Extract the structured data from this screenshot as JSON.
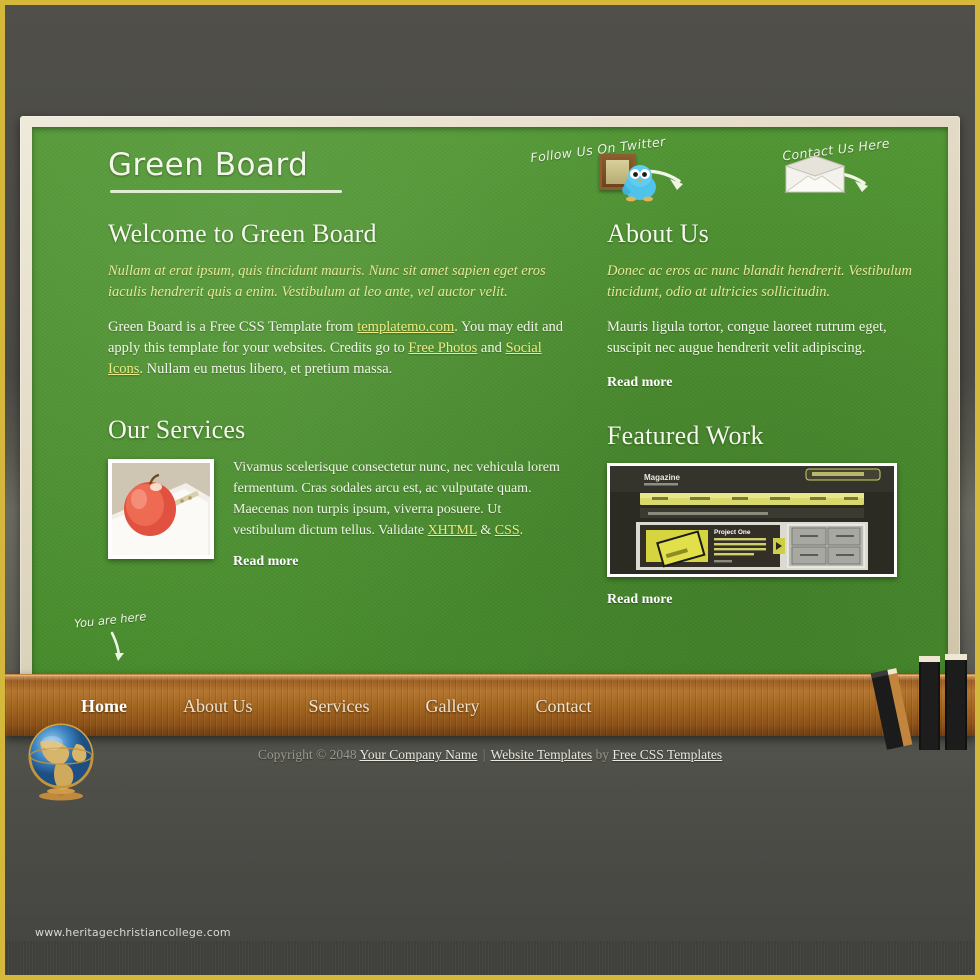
{
  "site": {
    "logo": "Green Board",
    "watermark": "www.heritagechristiancollege.com"
  },
  "header": {
    "twitter_caption": "Follow Us On Twitter",
    "contact_caption": "Contact Us Here",
    "twitter_icon": "twitter-bird-icon",
    "contact_icon": "envelope-icon"
  },
  "main": {
    "welcome": {
      "title": "Welcome to Green Board",
      "intro": "Nullam at erat ipsum, quis tincidunt mauris. Nunc sit amet sapien eget eros iaculis hendrerit quis a enim. Vestibulum at leo ante, vel auctor velit.",
      "body_1": "Green Board is a Free CSS Template from ",
      "link_templatemo": "templatemo.com",
      "body_2": ". You may edit and apply this template for your websites. Credits go to ",
      "link_free_photos": "Free Photos",
      "body_3": " and ",
      "link_social_icons": "Social Icons",
      "body_4": ". Nullam eu metus libero, et pretium massa."
    },
    "services": {
      "title": "Our Services",
      "image_alt": "apple-on-notebook-photo",
      "body_1": "Vivamus scelerisque consectetur nunc, nec vehicula lorem fermentum. Cras sodales arcu est, ac vulputate quam. Maecenas non turpis ipsum, viverra posuere. Ut vestibulum dictum tellus. Validate ",
      "link_xhtml": "XHTML",
      "amp": " & ",
      "link_css": "CSS",
      "body_2": ".",
      "read_more": "Read more"
    },
    "about": {
      "title": "About Us",
      "intro": "Donec ac eros ac nunc blandit hendrerit. Vestibulum tincidunt, odio at ultricies sollicitudin.",
      "body": "Mauris ligula tortor, congue laoreet rutrum eget, suscipit nec augue hendrerit velit adipiscing.",
      "read_more": "Read more"
    },
    "featured": {
      "title": "Featured Work",
      "image_alt": "magazine-website-screenshot",
      "thumb_brand": "Magazine",
      "thumb_project": "Project One",
      "read_more": "Read more"
    },
    "you_are_here": "You are here"
  },
  "nav": {
    "items": [
      {
        "label": "Home",
        "active": true
      },
      {
        "label": "About Us",
        "active": false
      },
      {
        "label": "Services",
        "active": false
      },
      {
        "label": "Gallery",
        "active": false
      },
      {
        "label": "Contact",
        "active": false
      }
    ]
  },
  "footer": {
    "copyright": "Copyright © 2048",
    "company": "Your Company Name",
    "separator": "|",
    "website_templates": "Website Templates",
    "by": "by",
    "free_css_templates": "Free CSS Templates"
  },
  "colors": {
    "outer_border": "#d4b83c",
    "backdrop": "#4c4c47",
    "board_green": "#4e9130",
    "board_frame": "#e4dcc7",
    "shelf_wood": "#a1641f",
    "accent_yellow": "#ecec84",
    "link_white": "#ffffff"
  }
}
